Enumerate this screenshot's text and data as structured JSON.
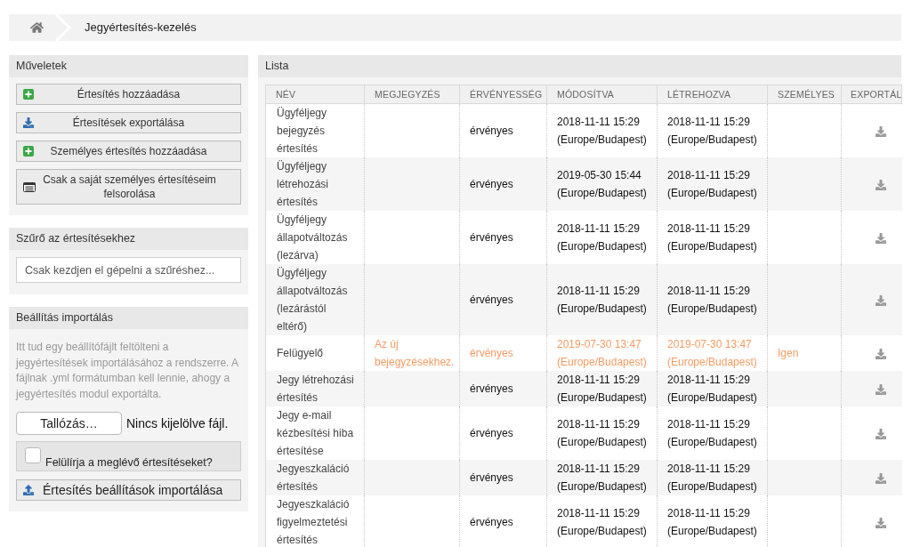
{
  "breadcrumb": {
    "title": "Jegyértesítés-kezelés"
  },
  "actions": {
    "title": "Műveletek",
    "buttons": [
      {
        "label": "Értesítés hozzáadása",
        "kind": "add"
      },
      {
        "label": "Értesítések exportálása",
        "kind": "export"
      },
      {
        "label": "Személyes értesítés hozzáadása",
        "kind": "add"
      },
      {
        "label": "Csak a saját személyes értesítéseim felsorolása",
        "kind": "list"
      }
    ]
  },
  "filter": {
    "title": "Szűrő az értesítésekhez",
    "placeholder": "Csak kezdjen el gépelni a szűréshez..."
  },
  "import": {
    "title": "Beállítás importálás",
    "description": "Itt tud egy beállítófájlt feltölteni a jegyértesítések importálásához a rendszerre. A fájlnak .yml formátumban kell lennie, ahogy a jegyértesítés modul exportálta.",
    "browse_button": "Tallózás…",
    "file_status": "Nincs kijelölve fájl.",
    "overwrite": {
      "label": "Felülírja a meglévő értesítéseket?",
      "checked": false
    },
    "submit": "Értesítés beállítások importálása"
  },
  "list": {
    "title": "Lista",
    "columns": [
      "NÉV",
      "MEGJEGYZÉS",
      "ÉRVÉNYESSÉG",
      "MÓDOSÍTVA",
      "LÉTREHOZVA",
      "SZEMÉLYES",
      "EXPORTÁL"
    ],
    "rows": [
      {
        "name": "Ügyféljegy bejegyzés értesítés",
        "validity": "érvényes",
        "changed": "2018-11-11 15:29 (Europe/Budapest)",
        "created": "2018-11-11 15:29 (Europe/Budapest)",
        "highlighted": false
      },
      {
        "name": "Ügyféljegy létrehozási értesítés",
        "validity": "érvényes",
        "changed": "2019-05-30 15:44 (Europe/Budapest)",
        "created": "2018-11-11 15:29 (Europe/Budapest)",
        "highlighted": false
      },
      {
        "name": "Ügyféljegy állapotváltozás (lezárva)",
        "validity": "érvényes",
        "changed": "2018-11-11 15:29 (Europe/Budapest)",
        "created": "2018-11-11 15:29 (Europe/Budapest)",
        "highlighted": false
      },
      {
        "name": "Ügyféljegy állapotváltozás (lezárástól eltérő)",
        "validity": "érvényes",
        "changed": "2018-11-11 15:29 (Europe/Budapest)",
        "created": "2018-11-11 15:29 (Europe/Budapest)",
        "highlighted": false
      },
      {
        "name": "Felügyelő",
        "comment": "Az új bejegyzésekhez.",
        "validity": "érvényes",
        "changed": "2019-07-30 13:47 (Europe/Budapest)",
        "created": "2019-07-30 13:47 (Europe/Budapest)",
        "personal": "Igen",
        "highlighted": true
      },
      {
        "name": "Jegy létrehozási értesítés",
        "validity": "érvényes",
        "changed": "2018-11-11 15:29 (Europe/Budapest)",
        "created": "2018-11-11 15:29 (Europe/Budapest)",
        "highlighted": false
      },
      {
        "name": "Jegy e-mail kézbesítési hiba értesítése",
        "validity": "érvényes",
        "changed": "2018-11-11 15:29 (Europe/Budapest)",
        "created": "2018-11-11 15:29 (Europe/Budapest)",
        "highlighted": false
      },
      {
        "name": "Jegyeszkaláció értesítés",
        "validity": "érvényes",
        "changed": "2018-11-11 15:29 (Europe/Budapest)",
        "created": "2018-11-11 15:29 (Europe/Budapest)",
        "highlighted": false
      },
      {
        "name": "Jegyeszkaláció figyelmeztetési értesítés",
        "validity": "érvényes",
        "changed": "2018-11-11 15:29 (Europe/Budapest)",
        "created": "2018-11-11 15:29 (Europe/Budapest)",
        "highlighted": false
      }
    ]
  }
}
